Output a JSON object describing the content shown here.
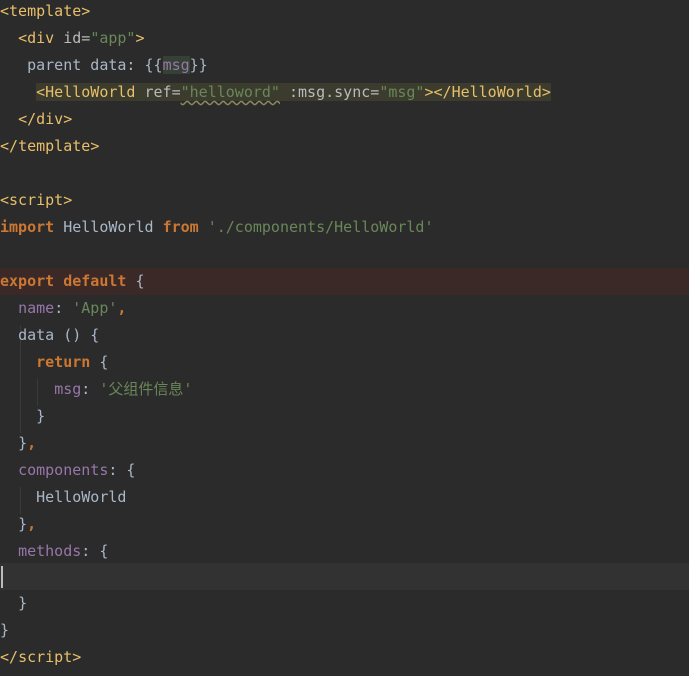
{
  "editor": {
    "l1": {
      "lt": "<",
      "name": "template",
      "gt": ">"
    },
    "l2": {
      "lt": "<",
      "name": "div",
      "attr": "id=",
      "val": "\"app\"",
      "gt": ">"
    },
    "l3": {
      "pre": "parent data: {{",
      "word": "msg",
      "post": "}}"
    },
    "l4": {
      "lt": "<",
      "name": "HelloWorld",
      "attr1": "ref=",
      "val1": "\"helloword\"",
      "attr2": ":msg.sync=",
      "val2": "\"msg\"",
      "close": "></",
      "name2": "HelloWorld",
      "gt": ">"
    },
    "l5": {
      "lt": "</",
      "name": "div",
      "gt": ">"
    },
    "l6": {
      "lt": "</",
      "name": "template",
      "gt": ">"
    },
    "l8": {
      "lt": "<",
      "name": "script",
      "gt": ">"
    },
    "l9": {
      "kw1": "import",
      "ident": " HelloWorld ",
      "kw2": "from",
      "path": "'./components/HelloWorld'"
    },
    "l11": {
      "kw1": "export",
      "kw2": "default",
      "brace": " {"
    },
    "l12": {
      "key": "name",
      "colon": ": ",
      "val": "'App'",
      "comma": ","
    },
    "l13": {
      "text": "data () {"
    },
    "l14": {
      "kw": "return",
      "brace": " {"
    },
    "l15": {
      "key": "msg",
      "colon": ": ",
      "val": "'父组件信息'"
    },
    "l16": {
      "text": "}"
    },
    "l17": {
      "text": "}",
      "comma": ","
    },
    "l18": {
      "key": "components",
      "rest": ": {"
    },
    "l19": {
      "text": "HelloWorld"
    },
    "l20": {
      "text": "}",
      "comma": ","
    },
    "l21": {
      "key": "methods",
      "rest": ": {"
    },
    "l23": {
      "text": "}"
    },
    "l24": {
      "text": "}"
    },
    "l25": {
      "lt": "</",
      "name": "script",
      "gt": ">"
    }
  },
  "colors": {
    "background": "#2b2b2b",
    "tag": "#e8bf6a",
    "string": "#6a8759",
    "keyword": "#cc7832",
    "property": "#9876aa",
    "text": "#a9b7c6",
    "breakpoint_line": "#3b2928"
  }
}
